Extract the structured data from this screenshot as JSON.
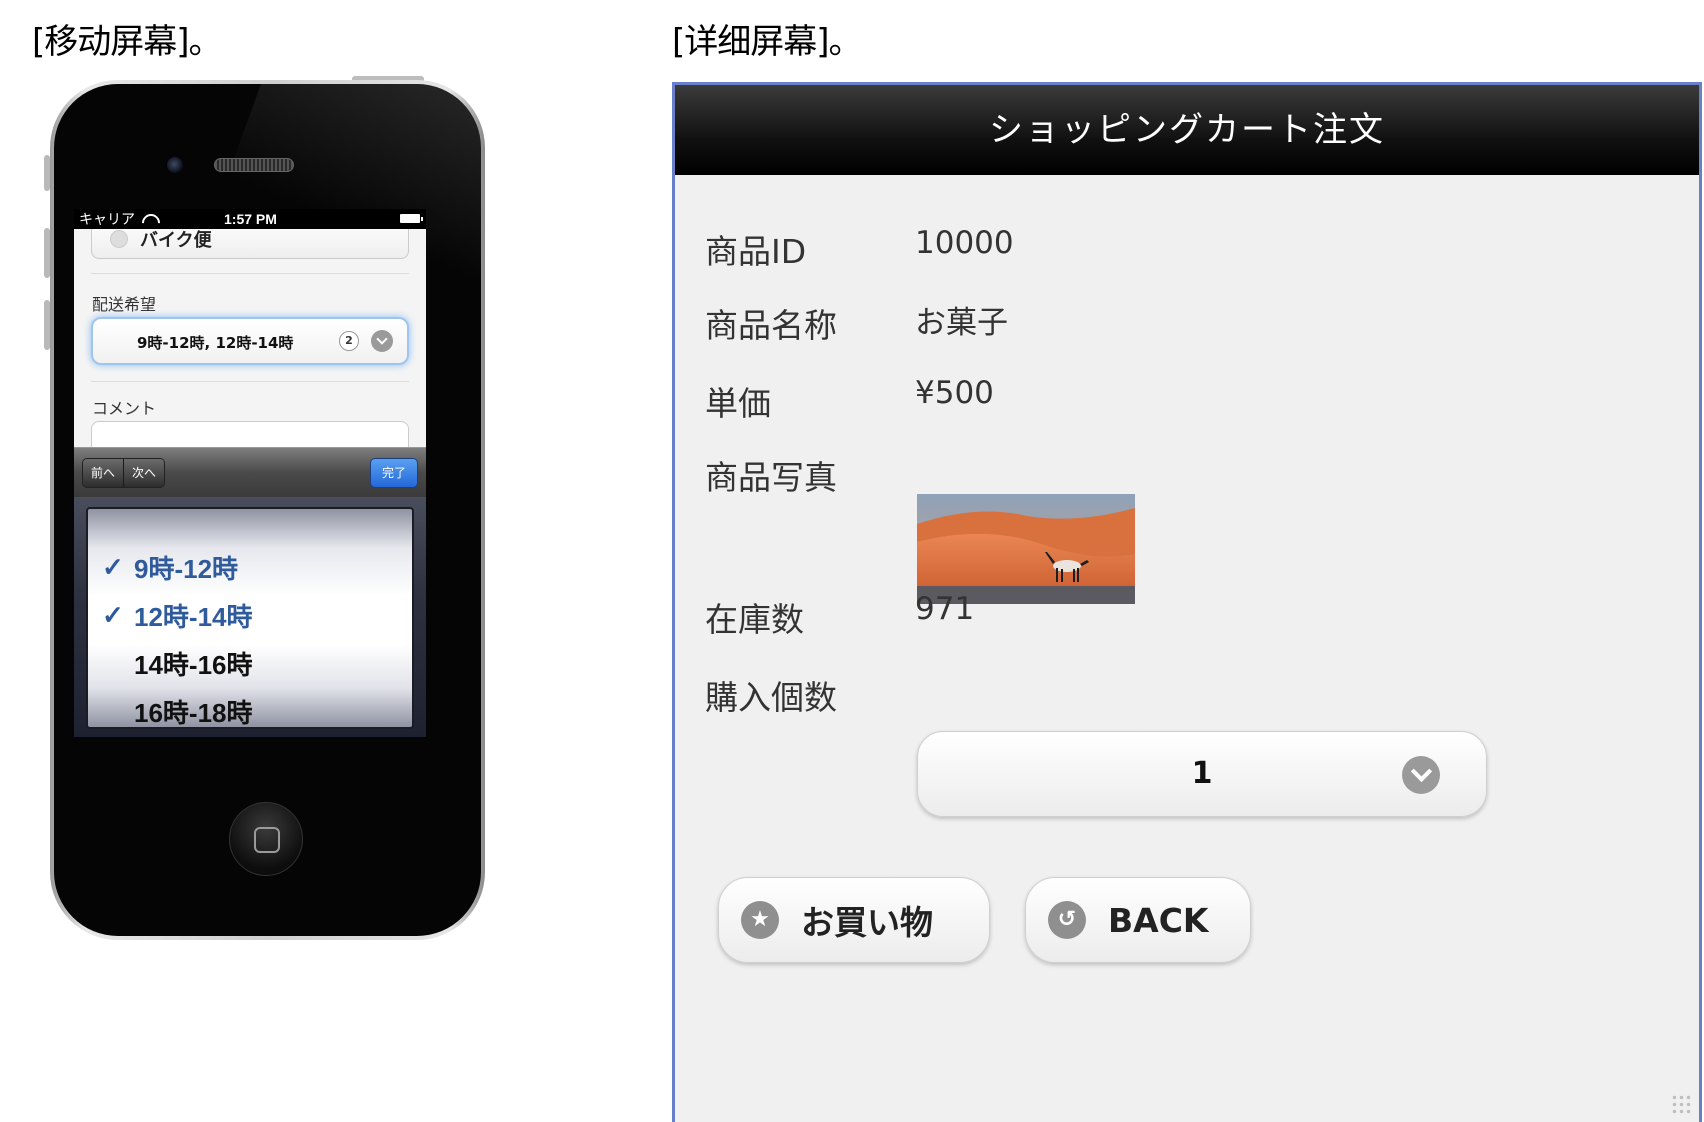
{
  "captions": {
    "left": "[移动屏幕]。",
    "right": "[详细屏幕]。"
  },
  "mobile": {
    "status": {
      "carrier": "キャリア",
      "time": "1:57 PM"
    },
    "form": {
      "bike_option": "バイク便",
      "delivery_label": "配送希望",
      "delivery_value": "9時-12時, 12時-14時",
      "delivery_count": "2",
      "comment_label": "コメント"
    },
    "toolbar": {
      "prev": "前へ",
      "next": "次へ",
      "done": "完了"
    },
    "picker": {
      "check": "✓",
      "options": [
        {
          "label": "9時-12時",
          "selected": true
        },
        {
          "label": "12時-14時",
          "selected": true
        },
        {
          "label": "14時-16時",
          "selected": false
        },
        {
          "label": "16時-18時",
          "selected": false
        }
      ]
    }
  },
  "detail": {
    "title": "ショッピングカート注文",
    "fields": {
      "id_label": "商品ID",
      "id_value": "10000",
      "name_label": "商品名称",
      "name_value": "お菓子",
      "price_label": "単価",
      "price_value": "¥500",
      "photo_label": "商品写真",
      "stock_label": "在庫数",
      "stock_value": "971",
      "qty_label": "購入個数",
      "qty_value": "1"
    },
    "buttons": {
      "buy": "お買い物",
      "back": "BACK"
    }
  },
  "colors": {
    "header_bg": "#111111",
    "selected_text": "#2f5b9c",
    "done_button": "#2468d8",
    "focus_ring": "#8cbcf0",
    "frame_border": "#6a7fc9"
  },
  "icons": [
    "wifi-icon",
    "battery-icon",
    "chevron-down-icon",
    "check-icon",
    "star-icon",
    "back-arrow-icon",
    "home-button-icon"
  ]
}
